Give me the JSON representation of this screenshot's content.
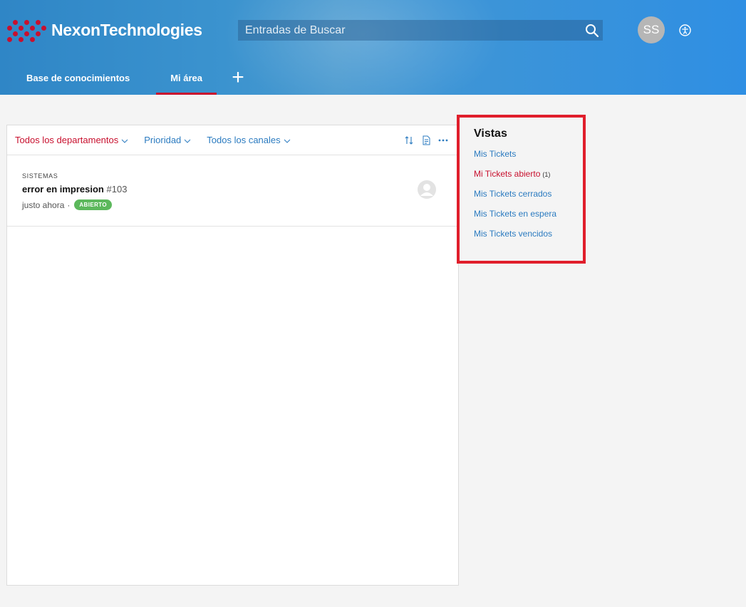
{
  "header": {
    "brand": "NexonTechnologies",
    "search_placeholder": "Entradas de Buscar",
    "avatar_initials": "SS",
    "nav": {
      "knowledge_base": "Base de conocimientos",
      "my_area": "Mi área",
      "add": "+"
    }
  },
  "toolbar": {
    "department_filter": "Todos los departamentos",
    "priority_filter": "Prioridad",
    "channels_filter": "Todos los canales"
  },
  "tickets": [
    {
      "department": "SISTEMAS",
      "subject": "error en impresion",
      "number": "#103",
      "time": "justo ahora",
      "separator": "·",
      "status": "ABIERTO"
    }
  ],
  "views": {
    "title": "Vistas",
    "items": [
      {
        "label": "Mis Tickets",
        "count": ""
      },
      {
        "label": "Mi Tickets abierto",
        "count": "(1)"
      },
      {
        "label": "Mis Tickets cerrados",
        "count": ""
      },
      {
        "label": "Mis Tickets en espera",
        "count": ""
      },
      {
        "label": "Mis Tickets vencidos",
        "count": ""
      }
    ]
  },
  "colors": {
    "brand_red": "#c8102e",
    "link_blue": "#2b7bc0",
    "header_blue": "#2f86c6",
    "status_green": "#5cb85c",
    "highlight_red": "#e01e2b"
  }
}
